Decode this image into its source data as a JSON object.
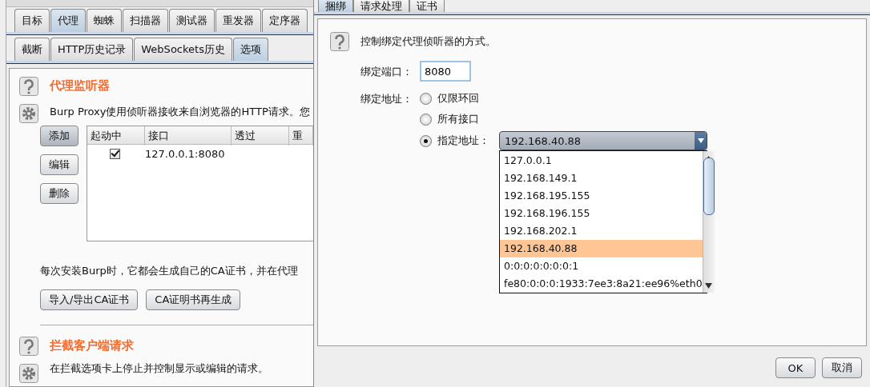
{
  "main_tabs": [
    {
      "label": "目标",
      "selected": false
    },
    {
      "label": "代理",
      "selected": true
    },
    {
      "label": "蜘蛛",
      "selected": false
    },
    {
      "label": "扫描器",
      "selected": false
    },
    {
      "label": "测试器",
      "selected": false
    },
    {
      "label": "重发器",
      "selected": false
    },
    {
      "label": "定序器",
      "selected": false
    }
  ],
  "sub_tabs": [
    {
      "label": "截断",
      "selected": false
    },
    {
      "label": "HTTP历史记录",
      "selected": false
    },
    {
      "label": "WebSockets历史",
      "selected": false
    },
    {
      "label": "选项",
      "selected": true
    }
  ],
  "listeners_section": {
    "title": "代理监听器",
    "description": "Burp Proxy使用侦听器接收来自浏览器的HTTP请求。您",
    "buttons": [
      "添加",
      "编辑",
      "删除"
    ],
    "columns": [
      "起动中",
      "接口",
      "透过",
      "重"
    ],
    "rows": [
      {
        "running": true,
        "interface": "127.0.0.1:8080"
      }
    ],
    "ca_note": "每次安装Burp时，它都会生成自己的CA证书，并在代理",
    "ca_buttons": [
      "导入/导出CA证书",
      "CA证明书再生成"
    ]
  },
  "intercept_section": {
    "title": "拦截客户端请求",
    "description": "在拦截选项卡上停止并控制显示或编辑的请求。"
  },
  "dialog": {
    "tabs": [
      {
        "label": "捆绑",
        "selected": true
      },
      {
        "label": "请求处理",
        "selected": false
      },
      {
        "label": "证书",
        "selected": false
      }
    ],
    "description": "控制绑定代理侦听器的方式。",
    "port_label": "绑定端口：",
    "port_value": "8080",
    "address_label": "绑定地址：",
    "address_options": [
      {
        "label": "仅限环回",
        "selected": false
      },
      {
        "label": "所有接口",
        "selected": false
      },
      {
        "label": "指定地址：",
        "selected": true
      }
    ],
    "address_combo": "192.168.40.88",
    "address_list": [
      {
        "label": "127.0.0.1",
        "selected": false
      },
      {
        "label": "192.168.149.1",
        "selected": false
      },
      {
        "label": "192.168.195.155",
        "selected": false
      },
      {
        "label": "192.168.196.155",
        "selected": false
      },
      {
        "label": "192.168.202.1",
        "selected": false
      },
      {
        "label": "192.168.40.88",
        "selected": true
      },
      {
        "label": "0:0:0:0:0:0:0:1",
        "selected": false
      },
      {
        "label": "fe80:0:0:0:1933:7ee3:8a21:ee96%eth0",
        "selected": false
      }
    ],
    "buttons": [
      "OK",
      "取消"
    ]
  }
}
